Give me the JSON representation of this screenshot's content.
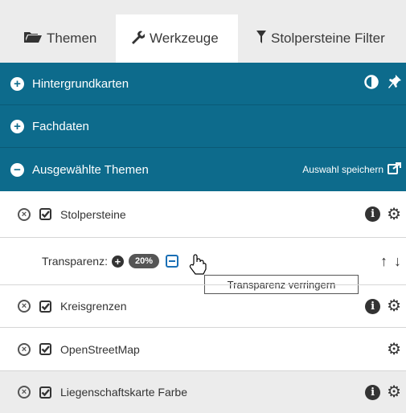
{
  "tabs": [
    {
      "label": "Themen",
      "icon": "folder-open-icon"
    },
    {
      "label": "Werkzeuge",
      "icon": "wrench-icon"
    },
    {
      "label": "Stolpersteine Filter",
      "icon": "filter-icon"
    }
  ],
  "sections": {
    "hintergrund": {
      "label": "Hintergrundkarten"
    },
    "fachdaten": {
      "label": "Fachdaten"
    },
    "ausgewaehlt": {
      "label": "Ausgewählte Themen",
      "save_label": "Auswahl speichern"
    }
  },
  "layers": [
    {
      "name": "Stolpersteine"
    },
    {
      "name": "Kreisgrenzen"
    },
    {
      "name": "OpenStreetMap"
    },
    {
      "name": "Liegenschaftskarte Farbe"
    }
  ],
  "transparency": {
    "label": "Transparenz:",
    "value": "20%"
  },
  "tooltip": "Transparenz verringern",
  "colors": {
    "accent": "#0d6b8c",
    "tab_bg": "#ececec"
  }
}
